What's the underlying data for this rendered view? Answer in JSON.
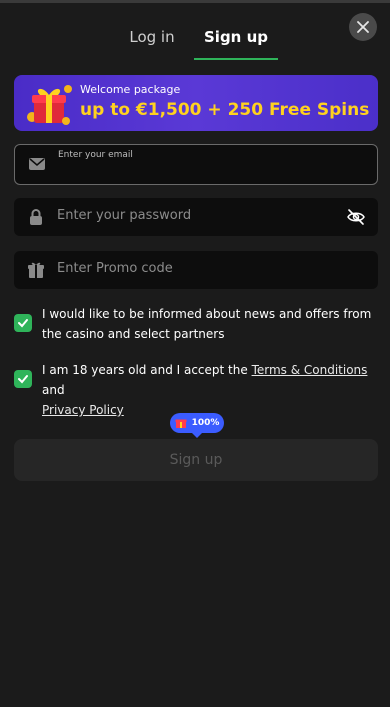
{
  "tabs": [
    {
      "label": "Log in",
      "active": false
    },
    {
      "label": "Sign up",
      "active": true
    }
  ],
  "banner": {
    "subtitle": "Welcome package",
    "title": "up to €1,500 + 250 Free Spins"
  },
  "form": {
    "email_placeholder": "Enter your email",
    "password_placeholder": "Enter your password",
    "promo_placeholder": "Enter Promo code"
  },
  "consents": {
    "news": {
      "text": "I would like to be informed about news and offers from the casino and select partners",
      "checked": true
    },
    "age": {
      "prefix": "I am 18 years old and I accept the ",
      "terms_link": "Terms & Conditions",
      "middle": " and ",
      "privacy_link": "Privacy Policy",
      "checked": true
    }
  },
  "progress_badge": {
    "text": "100%",
    "value": 1.0
  },
  "submit": {
    "label": "Sign up",
    "enabled": false
  },
  "icons": {
    "close": "close-icon",
    "email": "envelope-icon",
    "password": "lock-icon",
    "promo": "gift-icon",
    "visibility": "eye-off-icon"
  },
  "colors": {
    "accent_green": "#2fb45a",
    "banner_yellow": "#ffd21f",
    "badge_blue": "#3b5cff"
  }
}
